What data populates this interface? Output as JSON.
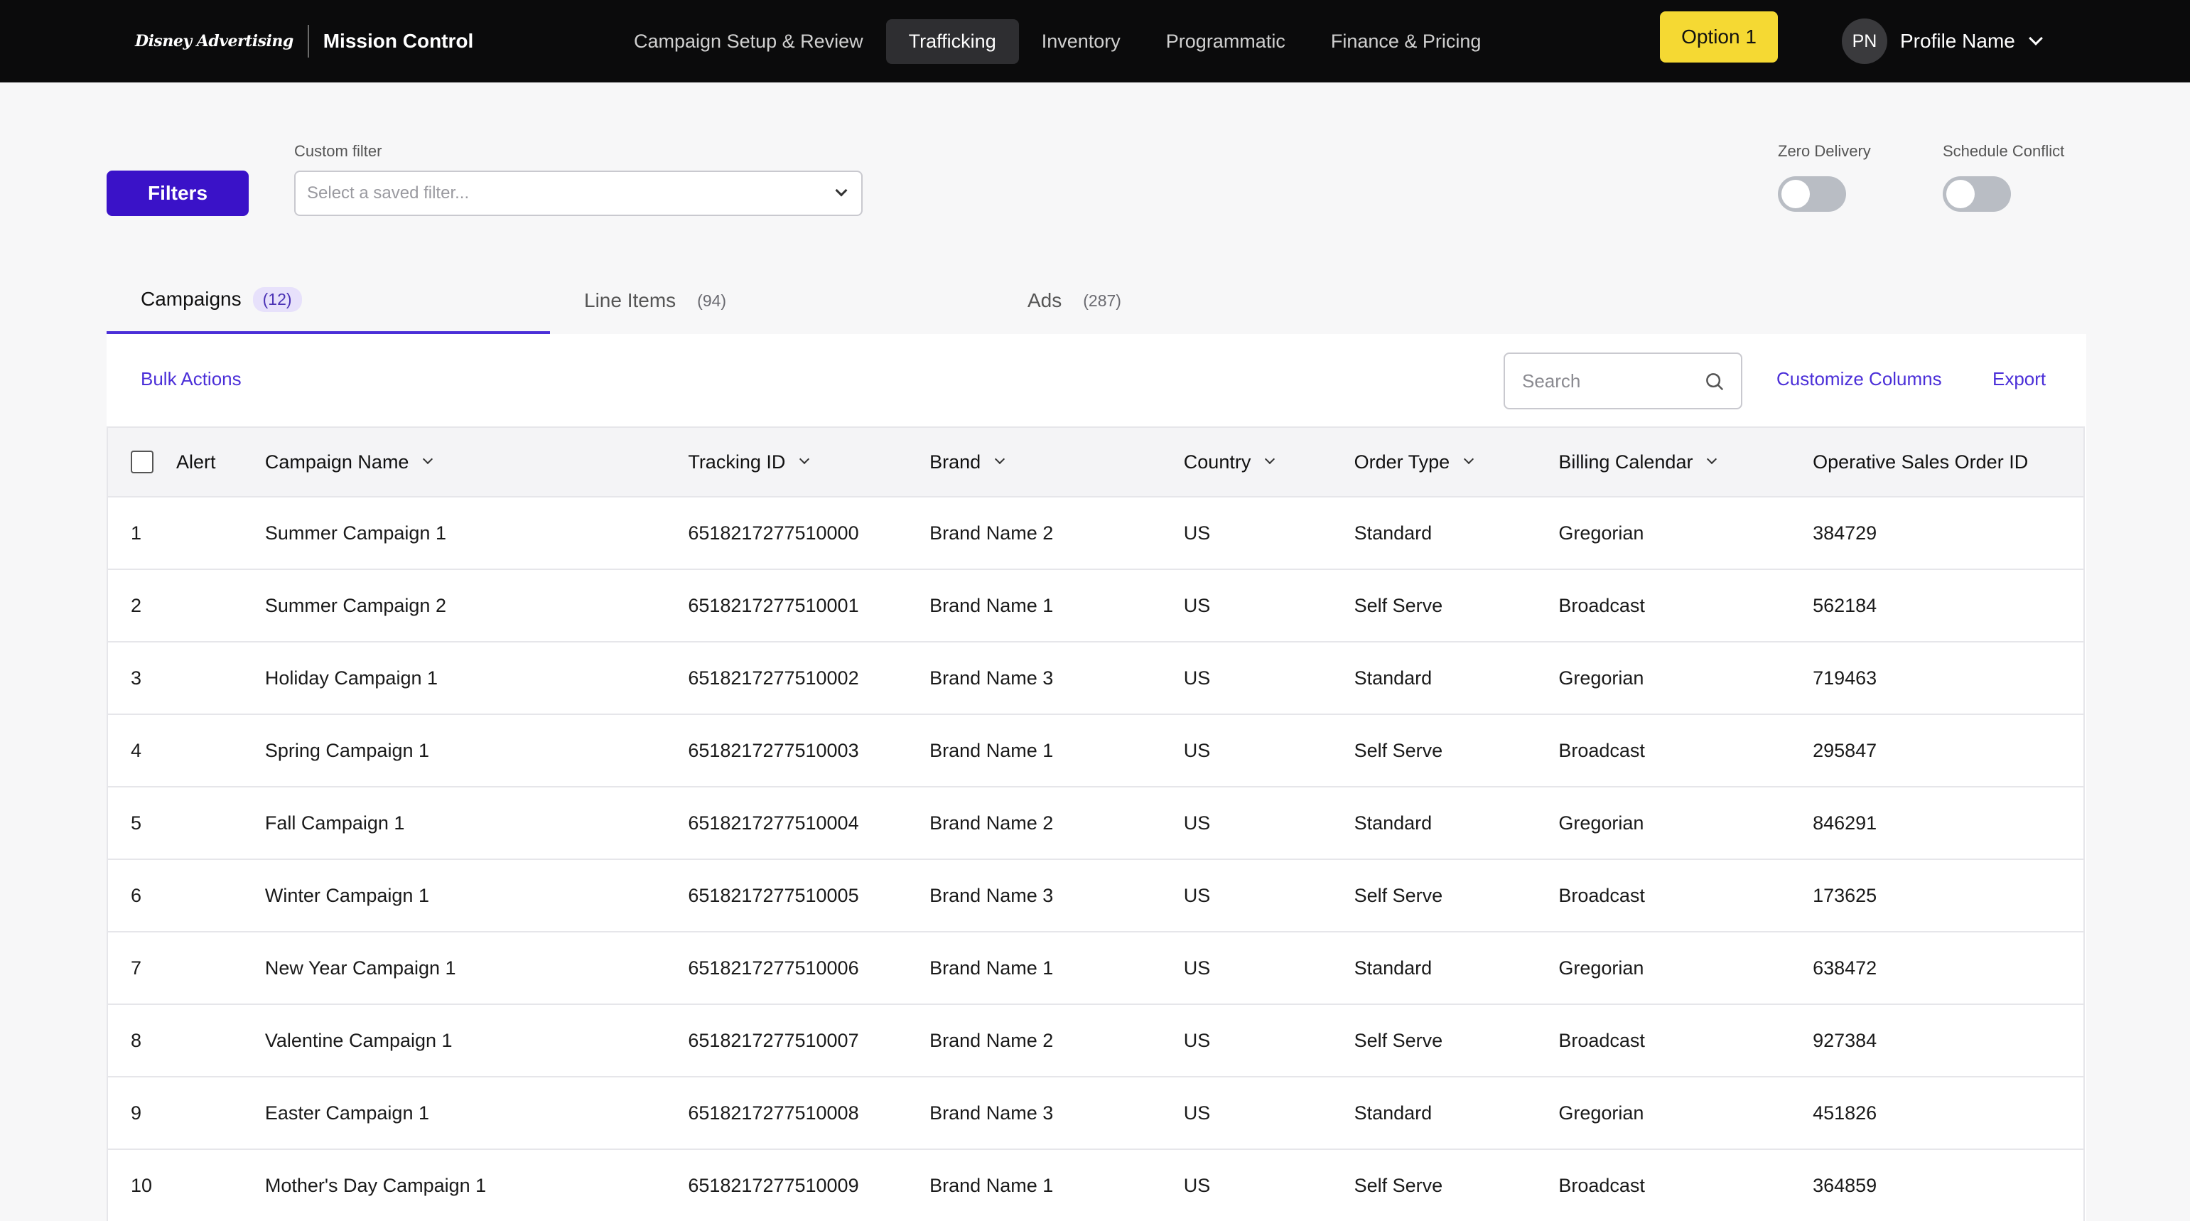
{
  "header": {
    "logo_text": "Disney Advertising",
    "app_name": "Mission Control",
    "nav": [
      "Campaign Setup & Review",
      "Trafficking",
      "Inventory",
      "Programmatic",
      "Finance & Pricing"
    ],
    "active_nav": "Trafficking",
    "option_button": "Option 1",
    "profile": {
      "initials": "PN",
      "name": "Profile Name"
    }
  },
  "filters": {
    "button_label": "Filters",
    "custom_filter_label": "Custom filter",
    "custom_filter_placeholder": "Select a saved filter...",
    "toggles": [
      {
        "label": "Zero Delivery",
        "on": false
      },
      {
        "label": "Schedule Conflict",
        "on": false
      }
    ]
  },
  "tabs": [
    {
      "label": "Campaigns",
      "count": "(12)",
      "active": true
    },
    {
      "label": "Line Items",
      "count": "(94)",
      "active": false
    },
    {
      "label": "Ads",
      "count": "(287)",
      "active": false
    }
  ],
  "toolbar": {
    "bulk_actions": "Bulk Actions",
    "search_placeholder": "Search",
    "customize_columns": "Customize Columns",
    "export": "Export"
  },
  "table": {
    "columns": [
      "Alert",
      "Campaign Name",
      "Tracking ID",
      "Brand",
      "Country",
      "Order Type",
      "Billing Calendar",
      "Operative Sales Order ID"
    ],
    "rows": [
      [
        "1",
        "Summer Campaign 1",
        "6518217277510000",
        "Brand Name 2",
        "US",
        "Standard",
        "Gregorian",
        "384729"
      ],
      [
        "2",
        "Summer Campaign 2",
        "6518217277510001",
        "Brand Name 1",
        "US",
        "Self Serve",
        "Broadcast",
        "562184"
      ],
      [
        "3",
        "Holiday Campaign 1",
        "6518217277510002",
        "Brand Name 3",
        "US",
        "Standard",
        "Gregorian",
        "719463"
      ],
      [
        "4",
        "Spring Campaign 1",
        "6518217277510003",
        "Brand Name 1",
        "US",
        "Self Serve",
        "Broadcast",
        "295847"
      ],
      [
        "5",
        "Fall Campaign 1",
        "6518217277510004",
        "Brand Name 2",
        "US",
        "Standard",
        "Gregorian",
        "846291"
      ],
      [
        "6",
        "Winter Campaign 1",
        "6518217277510005",
        "Brand Name 3",
        "US",
        "Self Serve",
        "Broadcast",
        "173625"
      ],
      [
        "7",
        "New Year Campaign 1",
        "6518217277510006",
        "Brand Name 1",
        "US",
        "Standard",
        "Gregorian",
        "638472"
      ],
      [
        "8",
        "Valentine Campaign 1",
        "6518217277510007",
        "Brand Name 2",
        "US",
        "Self Serve",
        "Broadcast",
        "927384"
      ],
      [
        "9",
        "Easter Campaign 1",
        "6518217277510008",
        "Brand Name 3",
        "US",
        "Standard",
        "Gregorian",
        "451826"
      ],
      [
        "10",
        "Mother's Day Campaign 1",
        "6518217277510009",
        "Brand Name 1",
        "US",
        "Self Serve",
        "Broadcast",
        "364859"
      ]
    ]
  },
  "colors": {
    "accent": "#3a12c8",
    "link": "#4b2fd8",
    "option_button": "#f5d933",
    "topbar": "#0b0b0c"
  }
}
